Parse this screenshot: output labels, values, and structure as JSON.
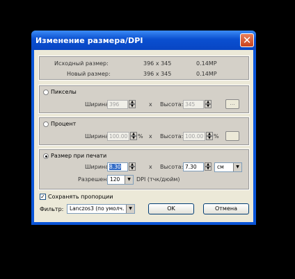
{
  "window": {
    "title": "Изменение размера/DPI",
    "close_label": "✕"
  },
  "info": {
    "original_label": "Исходный размер:",
    "original_dims": "396 x 345",
    "original_size": "0.14MP",
    "new_label": "Новый размер:",
    "new_dims": "396 x 345",
    "new_size": "0.14MP"
  },
  "pixels": {
    "label": "Пикселы",
    "width_label": "Ширина:",
    "width_value": "396",
    "x": "x",
    "height_label": "Высота:",
    "height_value": "345",
    "more_button": "..."
  },
  "percent": {
    "label": "Процент",
    "width_label": "Ширина:",
    "width_value": "100.00",
    "unit": "%",
    "x": "x",
    "height_label": "Высота:",
    "height_value": "100.00",
    "unit2": "%"
  },
  "print": {
    "label": "Размер при печати",
    "width_label": "Ширина:",
    "width_value": "8.30",
    "x": "x",
    "height_label": "Высота:",
    "height_value": "7.30",
    "unit_select": "см",
    "resolution_label": "Разрешение:",
    "resolution_value": "120",
    "resolution_unit": "DPI (тчк/дюйм)"
  },
  "options": {
    "keep_proportions": "Сохранять пропорции",
    "filter_label": "Фильтр:",
    "filter_value": "Lanczos3 (по умолч.",
    "ok": "OK",
    "cancel": "Отмена"
  }
}
